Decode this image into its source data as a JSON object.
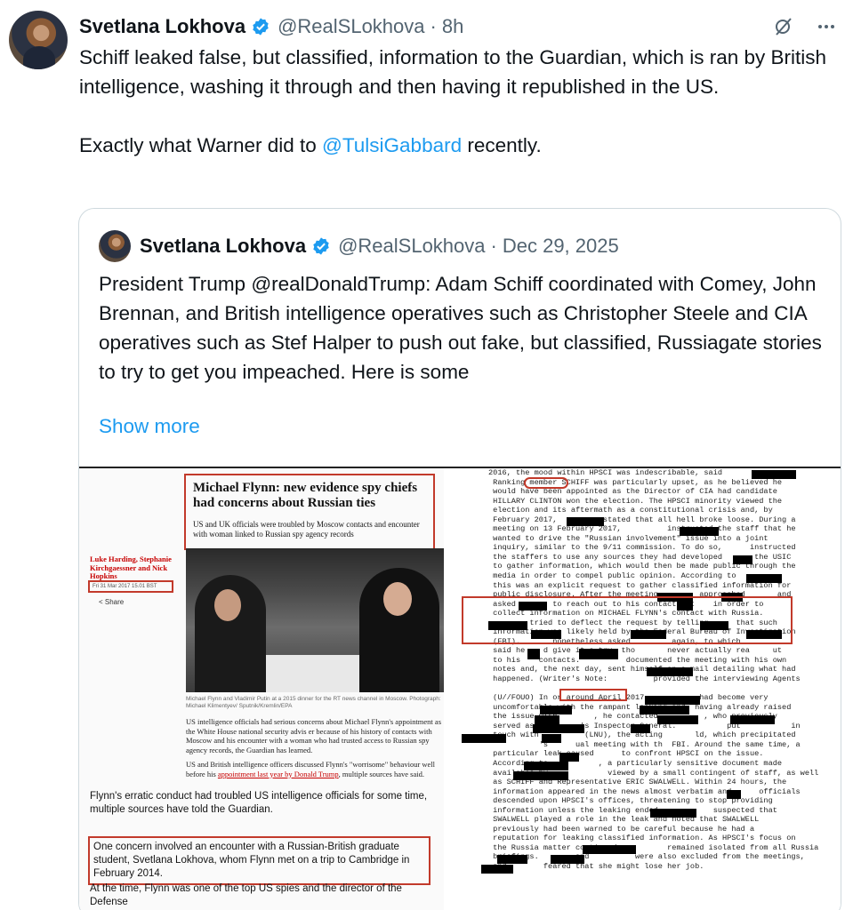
{
  "tweet": {
    "author_name": "Svetlana Lokhova",
    "handle": "@RealSLokhova",
    "time": "8h",
    "text_1": "Schiff leaked false, but classified, information to the Guardian, which is ran by British intelligence, washing it through and then having it republished in the US.",
    "text_2_prefix": "Exactly what Warner did to ",
    "text_2_mention": "@TulsiGabbard",
    "text_2_suffix": " recently."
  },
  "quoted": {
    "author_name": "Svetlana Lokhova",
    "handle": "@RealSLokhova",
    "date": "Dec 29, 2025",
    "text": "President Trump @realDonaldTrump: Adam Schiff coordinated with Comey, John Brennan, and British intelligence operatives such as Christopher Steele and CIA operatives such as Stef Halper to push out fake, but classified, Russiagate stories to try to get you impeached. Here is some",
    "show_more": "Show more",
    "image": {
      "headline": "Michael Flynn: new evidence spy chiefs had concerns about Russian ties",
      "standfirst": "US and UK officials were troubled by Moscow contacts and encounter with woman linked to Russian spy agency records",
      "authors": "Luke Harding, Stephanie Kirchgaessner and Nick Hopkins",
      "date": "Fri 31 Mar 2017 15.01 BST",
      "share": "< Share",
      "caption": "Michael Flynn and Vladimir Putin at a 2015 dinner for the RT news channel in Moscow. Photograph: Michael Klimentyev/ Sputnik/Kremlin/EPA",
      "body_1": "US intelligence officials had serious concerns about Michael Flynn's appointment as the White House national security advis er because of his history of contacts with Moscow and his encounter with a woman who had trusted access to Russian spy agency records, the Guardian has learned.",
      "body_2_prefix": "US and British intelligence officers discussed Flynn's \"worrisome\" behaviour well before his ",
      "body_2_link": "appointment last year by Donald Trump",
      "body_2_suffix": ", multiple sources have said.",
      "para_1": "Flynn's erratic conduct had troubled US intelligence officials for some time, multiple sources have told the Guardian.",
      "concern": "One concern involved an encounter with a Russian-British graduate student, Svetlana Lokhova, whom Flynn met on a trip to Cambridge in February 2014.",
      "para_2": "At the time, Flynn was one of the top US spies and the director of the Defense",
      "doc_text": "2016, the mood within HPSCI was indescribable, said\n Ranking member SCHIFF was particularly upset, as he believed he\n would have been appointed as the Director of CIA had candidate\n HILLARY CLINTON won the election. The HPSCI minority viewed the\n election and its aftermath as a constitutional crisis and, by\n February 2017,          stated that all hell broke loose. During a\n meeting on 13 February 2017,          instructed the staff that he\n wanted to drive the \"Russian involvement\" issue into a joint\n inquiry, similar to the 9/11 commission. To do so,      instructed\n the staffers to use any sources they had developed       the USIC\n to gather information, which would then be made public through the\n media in order to compel public opinion. According to\n this was an explicit request to gather classified information for\n public disclosure. After the meeting,        approached       and\n asked        to reach out to his contacts at    in order to\n collect information on MICHAEL FLYNN's contact with Russia.\n         tried to deflect the request by telling      that such\n information was likely held by the Federal Bureau of Investigation\n (FBI).       nonetheless asked         again, to which\n said he    d give it a try, tho       never actually rea     ut\n to his    contacts.          documented the meeting with his own\n notes and, the next day, sent himself an e-mail detailing what had\n happened. (Writer's Note:          provided the interviewing Agents\n\n (U//FOUO) In or around April 2017,           had become very\n uncomfortable with the rampant leaking and, having already raised\n the issue with        , he contacted          , who previously\n served as the      's Inspector General.           put           in\n touch with          (LNU), the acting       ld, which precipitated\n           's      ual meeting with th  FBI. Around the same time, a\n particular leak caused      to confront HPSCI on the issue.\n According to           , a particularly sensitive document made\n available by             viewed by a small contingent of staff, as well\n as SCHIFF and Representative ERIC SWALWELL. Within 24 hours, the\n information appeared in the news almost verbatim and      officials\n descended upon HPSCI's offices, threatening to stop providing\n information unless the leaking ended.           suspected that\n SWALWELL played a role in the leak and noted that SWALWELL\n previously had been warned to be careful because he had a\n reputation for leaking classified information. As HPSCI's focus on\n the Russia matter continued,          remained isolated from all Russia\n briefings.        and          were also excluded from the meetings,\n and        feared that she might lose her job."
    }
  },
  "colors": {
    "accent": "#1d9bf0",
    "annotation_red": "#c23a2b"
  },
  "icons": [
    "verified-badge-icon",
    "grok-icon",
    "more-icon"
  ]
}
